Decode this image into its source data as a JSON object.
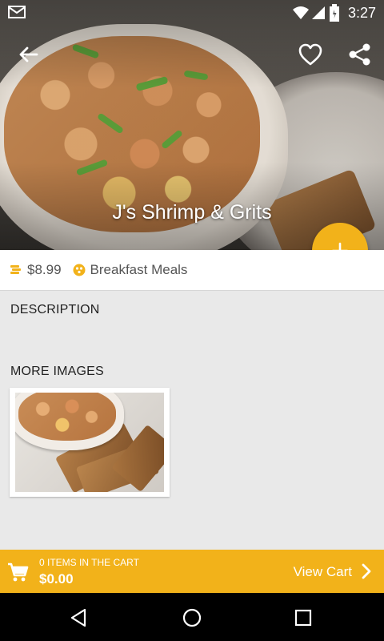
{
  "status_bar": {
    "time": "3:27",
    "icons": [
      "gmail-icon",
      "wifi-icon",
      "signal-icon",
      "battery-icon"
    ]
  },
  "header": {
    "title": "J's Shrimp & Grits",
    "icons": [
      "back-arrow-icon",
      "heart-outline-icon",
      "share-icon"
    ]
  },
  "fab": {
    "icon": "plus-icon"
  },
  "info": {
    "price": "$8.99",
    "price_icon": "coins-icon",
    "category": "Breakfast Meals",
    "category_icon": "category-icon"
  },
  "sections": {
    "description_label": "DESCRIPTION",
    "more_images_label": "MORE IMAGES"
  },
  "cart": {
    "count_text": "0 ITEMS IN THE CART",
    "total": "$0.00",
    "view_label": "View Cart"
  },
  "colors": {
    "accent": "#f2b21a",
    "background": "#e9e9e9"
  }
}
